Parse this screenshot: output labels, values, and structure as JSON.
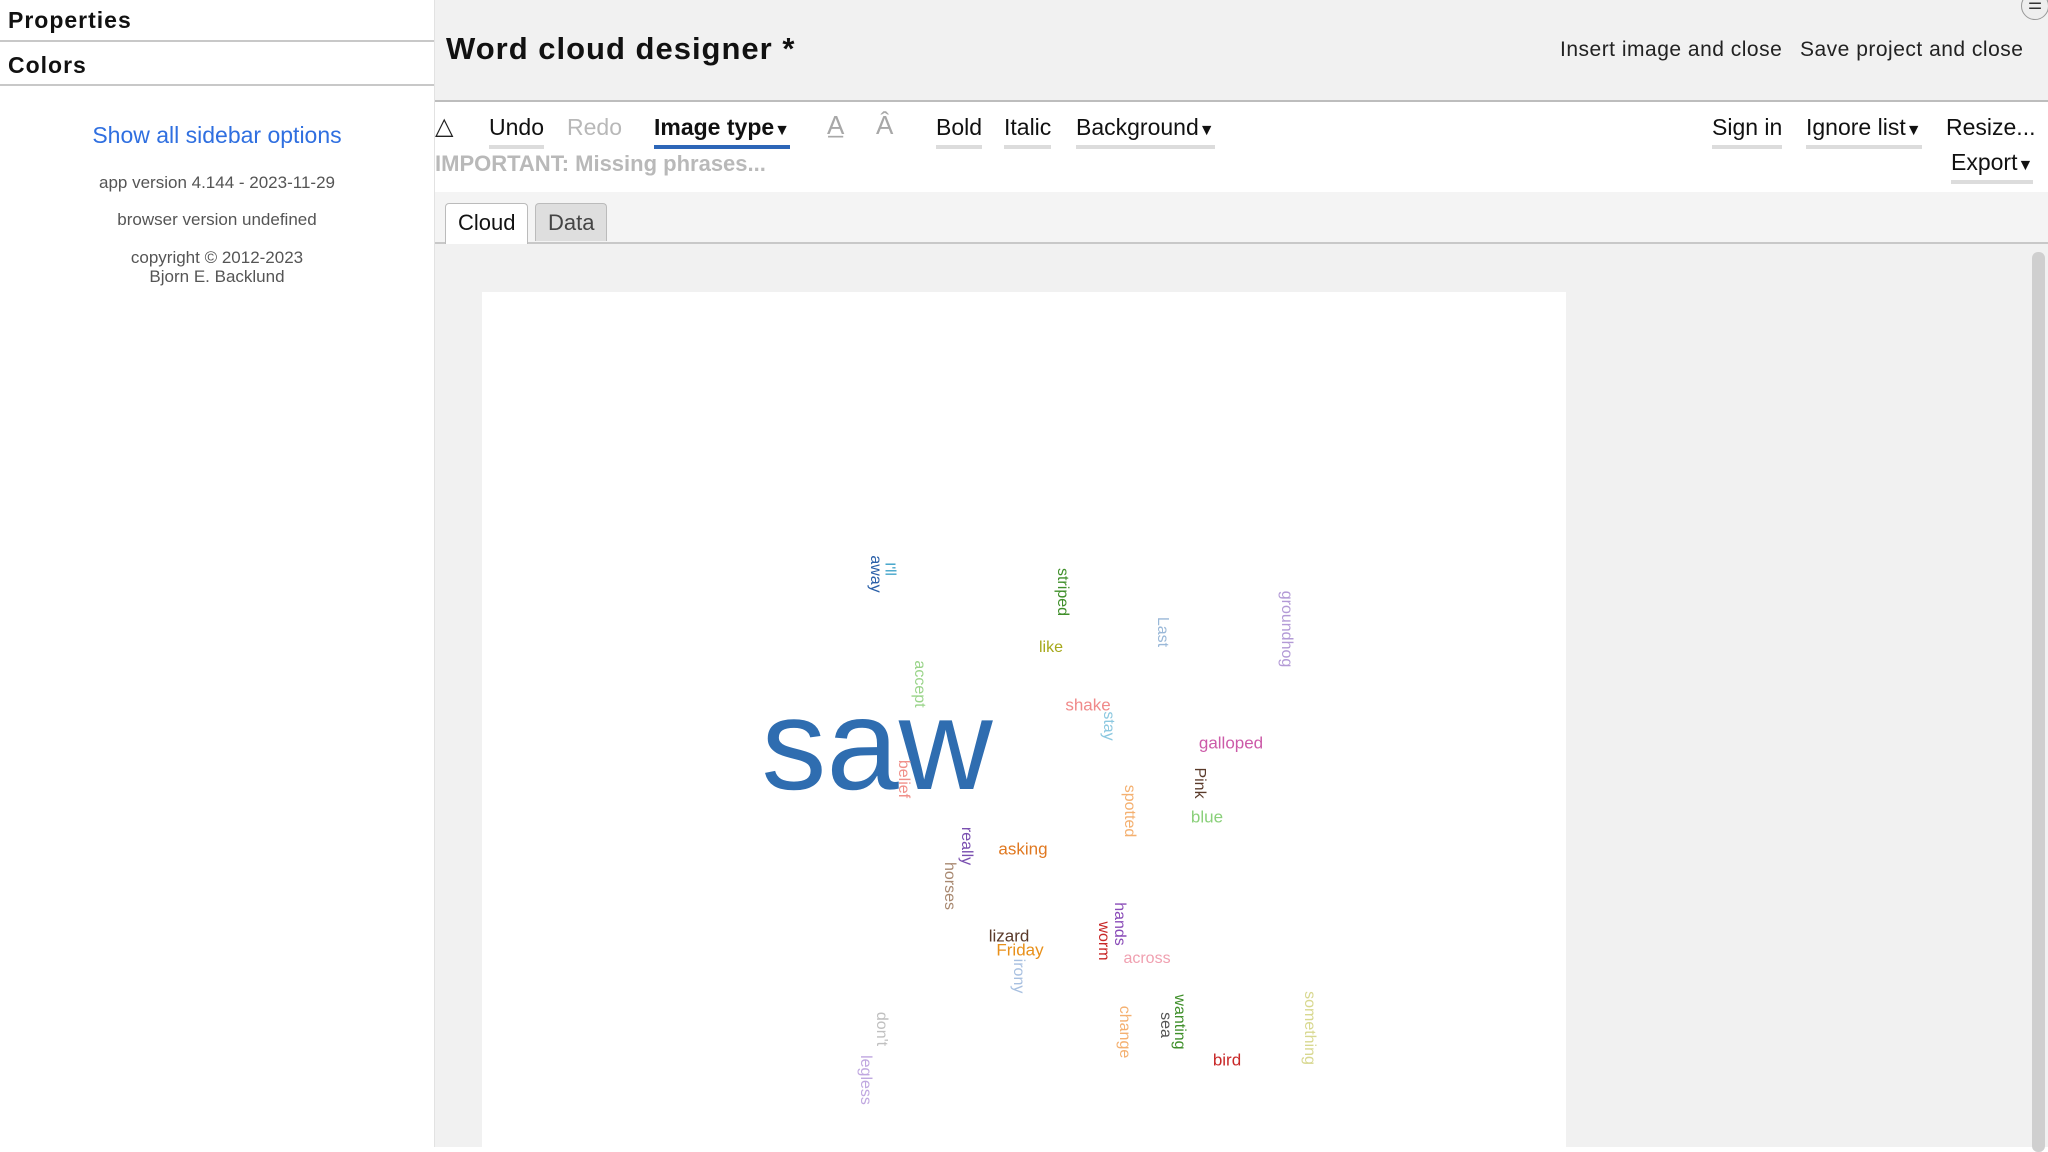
{
  "sidebar": {
    "properties_label": "Properties",
    "colors_label": "Colors",
    "show_all_link": "Show all sidebar options",
    "app_version": "app version 4.144 - 2023-11-29",
    "browser_version": "browser version undefined",
    "copyright_line1": "copyright © 2012-2023",
    "copyright_line2": "Bjorn E. Backlund"
  },
  "header": {
    "title": "Word cloud designer *",
    "insert_close": "Insert image and close",
    "save_close": "Save project and close",
    "menu_icon": "hamburger-icon"
  },
  "toolbar": {
    "recycle_icon": "recycle-icon",
    "undo": "Undo",
    "redo": "Redo",
    "image_type": "Image type",
    "font_decrease_icon": "font-decrease-icon",
    "font_increase_icon": "font-increase-icon",
    "bold": "Bold",
    "italic": "Italic",
    "background": "Background",
    "sign_in": "Sign in",
    "ignore_list": "Ignore list",
    "resize": "Resize...",
    "export": "Export",
    "warning": "IMPORTANT: Missing phrases..."
  },
  "tabs": [
    {
      "label": "Cloud",
      "active": true
    },
    {
      "label": "Data",
      "active": false
    }
  ],
  "cloud": {
    "words": [
      {
        "text": "saw",
        "color": "#2f6db0",
        "rotate": 0
      },
      {
        "text": "I'll",
        "color": "#3aa0c8",
        "rotate": 90
      },
      {
        "text": "away",
        "color": "#2a5fa8",
        "rotate": 90
      },
      {
        "text": "striped",
        "color": "#3f8f2a",
        "rotate": 90
      },
      {
        "text": "Last",
        "color": "#9ab8d8",
        "rotate": 90
      },
      {
        "text": "groundhog",
        "color": "#b39ad6",
        "rotate": 90
      },
      {
        "text": "like",
        "color": "#a6a81a",
        "rotate": 0
      },
      {
        "text": "accept",
        "color": "#9ad48a",
        "rotate": 90
      },
      {
        "text": "shake",
        "color": "#f08a8a",
        "rotate": 0
      },
      {
        "text": "stay",
        "color": "#8cc8e0",
        "rotate": 90
      },
      {
        "text": "galloped",
        "color": "#cc5aa8",
        "rotate": 0
      },
      {
        "text": "belief",
        "color": "#f0908a",
        "rotate": 90
      },
      {
        "text": "Pink",
        "color": "#5a3a2a",
        "rotate": 90
      },
      {
        "text": "spotted",
        "color": "#f4b070",
        "rotate": 90
      },
      {
        "text": "blue",
        "color": "#8ad07a",
        "rotate": 0
      },
      {
        "text": "really",
        "color": "#7a4fb0",
        "rotate": 90
      },
      {
        "text": "asking",
        "color": "#e07820",
        "rotate": 0
      },
      {
        "text": "horses",
        "color": "#a88870",
        "rotate": 90
      },
      {
        "text": "hands",
        "color": "#8a4cb8",
        "rotate": 90
      },
      {
        "text": "lizard",
        "color": "#5a3a2a",
        "rotate": 0
      },
      {
        "text": "worm",
        "color": "#c82828",
        "rotate": 90
      },
      {
        "text": "Friday",
        "color": "#e8901a",
        "rotate": 0
      },
      {
        "text": "across",
        "color": "#f0a0b0",
        "rotate": 0
      },
      {
        "text": "irony",
        "color": "#a8c0e0",
        "rotate": 90
      },
      {
        "text": "don't",
        "color": "#c0c0c0",
        "rotate": 90
      },
      {
        "text": "change",
        "color": "#f4b070",
        "rotate": 90
      },
      {
        "text": "sea",
        "color": "#555555",
        "rotate": 90
      },
      {
        "text": "wanting",
        "color": "#3f8f2a",
        "rotate": 90
      },
      {
        "text": "something",
        "color": "#d8d890",
        "rotate": 90
      },
      {
        "text": "bird",
        "color": "#c82828",
        "rotate": 0
      },
      {
        "text": "legless",
        "color": "#c0a8e0",
        "rotate": 90
      }
    ]
  }
}
